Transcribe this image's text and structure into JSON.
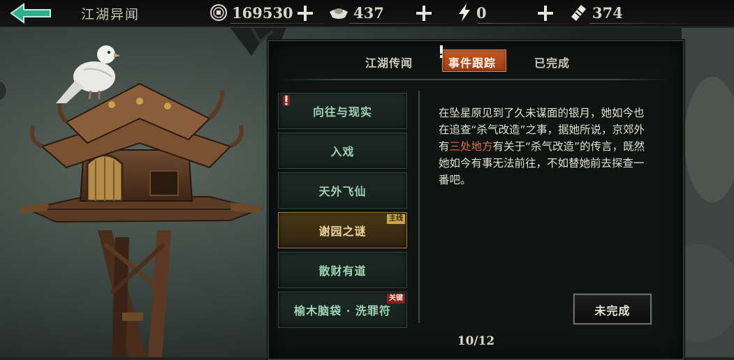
{
  "header": {
    "title": "江湖异闻",
    "back_icon": "back-arrow-icon"
  },
  "resources": [
    {
      "name": "copper-coin",
      "icon": "coin-icon",
      "value": "169530"
    },
    {
      "name": "silver-ingot",
      "icon": "silver-ingot-icon",
      "value": "437"
    },
    {
      "name": "energy",
      "icon": "lightning-icon",
      "value": "0"
    },
    {
      "name": "ticket",
      "icon": "ticket-icon",
      "value": "374"
    }
  ],
  "tabs": [
    {
      "label": "江湖传闻",
      "active": false
    },
    {
      "label": "事件跟踪",
      "active": true
    },
    {
      "label": "已完成",
      "active": false
    }
  ],
  "quests": [
    {
      "label": "向往与现实",
      "badge": "",
      "alert": true,
      "selected": false
    },
    {
      "label": "入戏",
      "badge": "",
      "alert": false,
      "selected": false
    },
    {
      "label": "天外飞仙",
      "badge": "",
      "alert": false,
      "selected": false
    },
    {
      "label": "谢园之谜",
      "badge": "主线",
      "alert": false,
      "selected": true
    },
    {
      "label": "散财有道",
      "badge": "",
      "alert": false,
      "selected": false
    },
    {
      "label": "榆木脑袋 · 洗罪符",
      "badge": "关键",
      "alert": false,
      "selected": false
    }
  ],
  "description": {
    "part1": "在坠星原见到了久未谋面的银月，她如今也在追查“杀气改造”之事，据她所说，京郊外有",
    "highlight": "三处地方",
    "part2": "有关于“杀气改造”的传言，既然她如今有事无法前往，不如替她前去探查一番吧。"
  },
  "status_button": "未完成",
  "pager": "10/12",
  "colors": {
    "accent_tab": "#c25a26",
    "quest_text": "#9fd3b8",
    "selected_quest": "#f0d59a",
    "highlight_text": "#e0703a"
  }
}
